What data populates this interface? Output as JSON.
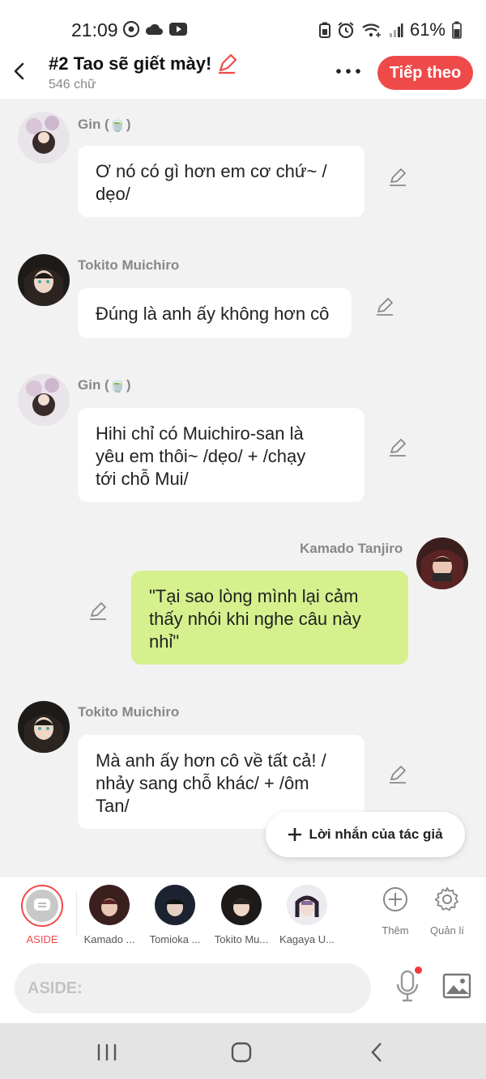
{
  "status": {
    "time": "21:09",
    "battery": "61%"
  },
  "header": {
    "title": "#2 Tao sẽ giết mày!",
    "subtitle": "546 chữ",
    "next_label": "Tiếp theo"
  },
  "messages": [
    {
      "name": "Gin (🍵)",
      "text": "Ơ nó có gì hơn em cơ chứ~ /\ndẹo/",
      "mine": false
    },
    {
      "name": "Tokito Muichiro",
      "text": "Đúng là anh ấy không hơn cô",
      "mine": false
    },
    {
      "name": "Gin (🍵)",
      "text": "Hihi chỉ có Muichiro-san là\nyêu em thôi~ /dẹo/ + /chạy\ntới chỗ Mui/",
      "mine": false
    },
    {
      "name": "Kamado Tanjiro",
      "text": "\"Tại sao lòng mình lại cảm\nthấy nhói khi nghe câu này\nnhỉ\"",
      "mine": true
    },
    {
      "name": "Tokito Muichiro",
      "text": "Mà anh ấy hơn cô về tất cả! /\nnhảy sang chỗ khác/ + /ôm\nTan/",
      "mine": false
    }
  ],
  "author_note_label": "Lời nhắn của tác giả",
  "cast": {
    "aside_label": "ASIDE",
    "members": [
      {
        "label": "Kamado ..."
      },
      {
        "label": "Tomioka ..."
      },
      {
        "label": "Tokito Mu..."
      },
      {
        "label": "Kagaya U..."
      }
    ],
    "add_label": "Thêm",
    "manage_label": "Quản lí"
  },
  "input": {
    "placeholder": "ASIDE:"
  },
  "colors": {
    "accent": "#ef4a4a",
    "mine_bubble": "#d6f08d",
    "background": "#f2f2f2"
  }
}
